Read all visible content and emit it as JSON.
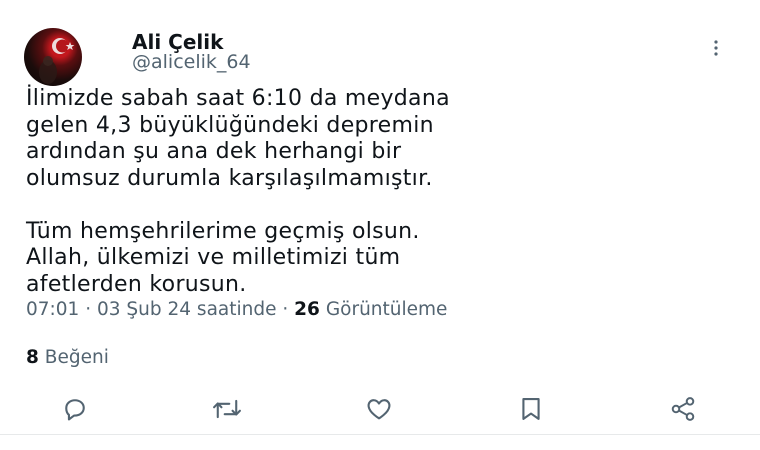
{
  "user": {
    "display_name": "Ali Çelik",
    "handle": "@alicelik_64"
  },
  "tweet": {
    "text": "İlimizde sabah saat 6:10 da meydana\ngelen 4,3 büyüklüğündeki depremin\nardından şu ana dek herhangi bir\nolumsuz durumla karşılaşılmamıştır.\n\nTüm hemşehrilerime geçmiş olsun.\nAllah, ülkemizi ve milletimizi tüm\nafetlerden korusun.",
    "time": "07:01",
    "separator_1": "·",
    "date": "03 Şub 24 saatinde",
    "separator_2": "·",
    "views_count": "26",
    "views_label": "Görüntüleme",
    "likes_count": "8",
    "likes_label": "Beğeni"
  },
  "actions": [
    {
      "icon": "reply-icon"
    },
    {
      "icon": "retweet-icon"
    },
    {
      "icon": "like-icon"
    },
    {
      "icon": "bookmark-icon"
    },
    {
      "icon": "share-icon"
    }
  ],
  "colors": {
    "text_primary": "#0f1419",
    "text_secondary": "#536471",
    "divider": "#e7e9ea",
    "avatar_flag_red": "#c3171d"
  }
}
